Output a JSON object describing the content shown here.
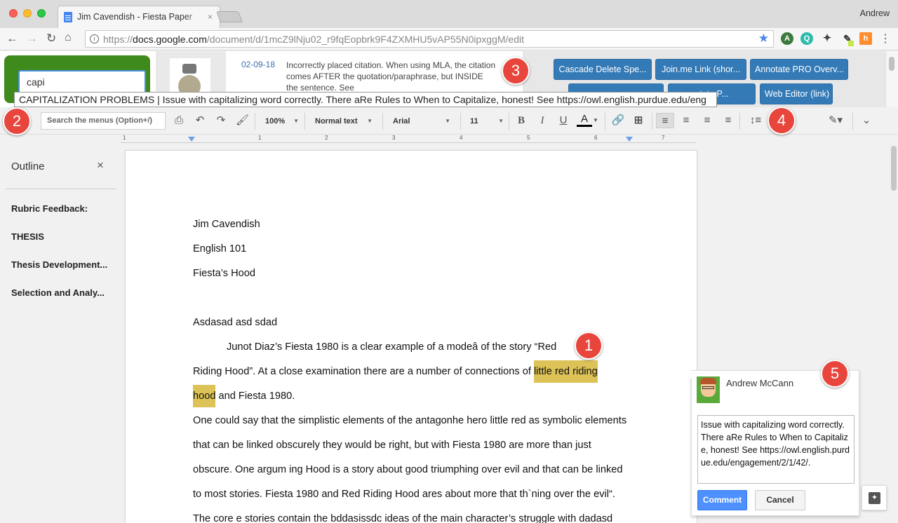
{
  "browser": {
    "tab_title": "Jim Cavendish - Fiesta Paper",
    "tab_close": "×",
    "profile_name": "Andrew",
    "url_prefix": "https://",
    "url_host": "docs.google.com",
    "url_path": "/document/d/1mcZ9lNju02_r9fqEopbrk9F4ZXMHU5vAP55N0ipxggM/edit",
    "icons": [
      "back-icon",
      "forward-icon",
      "reload-icon",
      "home-icon",
      "info-icon",
      "star-icon",
      "menu-icon"
    ],
    "extensions": {
      "a": "A",
      "q": "Q",
      "hs": "h"
    }
  },
  "plugin": {
    "search_value": "capi",
    "date": "02-09-18",
    "description": "Incorrectly placed citation. When using MLA, the citation comes AFTER the quotation/paraphrase, but INSIDE the sentence. See",
    "buttons": {
      "cascade": "Cascade Delete Spe...",
      "joinme": "Join.me Link (shor...",
      "annotate_pro": "Annotate PRO Overv...",
      "row2a": "",
      "row2b": "otate P...",
      "web_editor": "Web Editor (link)"
    },
    "tooltip": "CAPITALIZATION PROBLEMS | Issue with capitalizing word correctly. There aRe Rules to When to Capitalize, honest! See https://owl.english.purdue.edu/eng"
  },
  "badges": {
    "b1": "1",
    "b2": "2",
    "b3": "3",
    "b4": "4",
    "b5": "5"
  },
  "toolbar": {
    "menu_search_placeholder": "Search the menus (Option+/)",
    "zoom": "100%",
    "style": "Normal text",
    "font": "Arial",
    "size": "11",
    "bold": "B",
    "italic": "I",
    "underline": "U",
    "text_color": "A"
  },
  "ruler": {
    "numbers": [
      "1",
      "1",
      "2",
      "3",
      "4",
      "5",
      "6",
      "7"
    ]
  },
  "outline": {
    "title": "Outline",
    "close": "×",
    "items": [
      "Rubric Feedback:",
      "THESIS",
      "Thesis Development...",
      "Selection and Analy..."
    ]
  },
  "document": {
    "line1": " Jim Cavendish",
    "line2": "English 101",
    "line3": "Fiesta’s Hood",
    "line4": "Asdasad asd sdad",
    "line5": "Junot Diaz’s Fiesta 1980 is a clear example of a modeâ of the story “Red",
    "line6_pre": "Riding Hood”. At a close examination there are a number of connections   of ",
    "line6_hl": "little red riding",
    "line7_hl": "hood",
    "line7_post": " and Fiesta 1980.",
    "line8": "One could say that the simplistic elements of the antagonhe hero little red as symbolic elements",
    "line9": "that can be linked obscurely they would be right, but with Fiesta 1980 are more than just",
    "line10": "obscure. One argum ing Hood is a story about good triumphing over evil and that can be linked",
    "line11": "to most stories. Fiesta 1980 and Red Riding Hood ares about more that th`ning over the evil“.",
    "line12": "The core e  stories contain the bddasissdc ideas of the main character’s struggle with dadasd"
  },
  "comment": {
    "author": "Andrew McCann",
    "text": "Issue with capitalizing word correctly. There aRe Rules to When to Capitalize, honest! See https://owl.english.purdue.edu/engagement/2/1/42/.",
    "comment_label": "Comment",
    "cancel_label": "Cancel"
  },
  "colors": {
    "accent_green": "#3f8a1c",
    "button_blue": "#337ab7",
    "badge_red": "#e8453c",
    "highlight": "#dcc257",
    "comment_blue": "#4d90fe"
  }
}
